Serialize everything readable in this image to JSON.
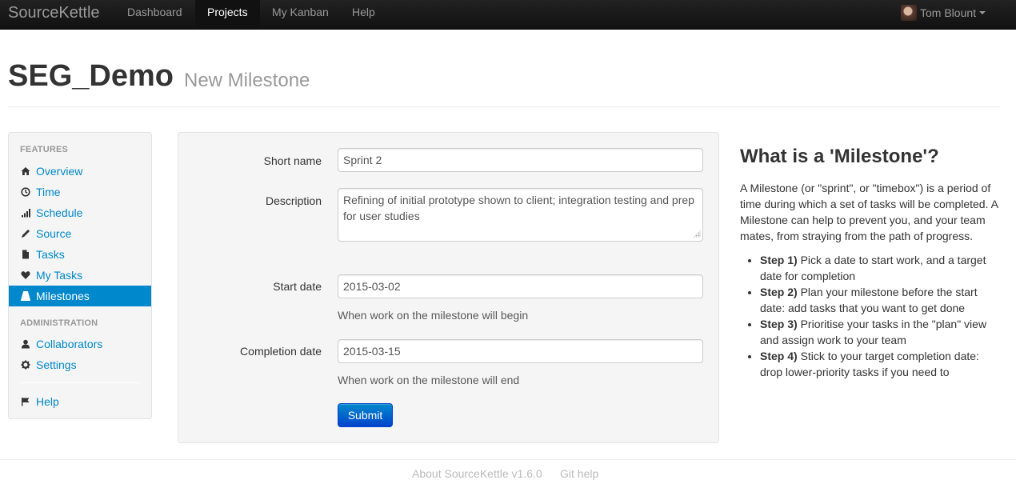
{
  "navbar": {
    "brand": "SourceKettle",
    "items": [
      {
        "label": "Dashboard"
      },
      {
        "label": "Projects"
      },
      {
        "label": "My Kanban"
      },
      {
        "label": "Help"
      }
    ],
    "active_item": "Projects",
    "user": "Tom Blount"
  },
  "header": {
    "title": "SEG_Demo",
    "subtitle": "New Milestone"
  },
  "sidebar": {
    "features_header": "FEATURES",
    "features": [
      {
        "label": "Overview",
        "icon": "home-icon"
      },
      {
        "label": "Time",
        "icon": "clock-icon"
      },
      {
        "label": "Schedule",
        "icon": "signal-icon"
      },
      {
        "label": "Source",
        "icon": "pencil-icon"
      },
      {
        "label": "Tasks",
        "icon": "file-icon"
      },
      {
        "label": "My Tasks",
        "icon": "heart-icon"
      },
      {
        "label": "Milestones",
        "icon": "road-icon"
      }
    ],
    "active_item": "Milestones",
    "admin_header": "ADMINISTRATION",
    "admin": [
      {
        "label": "Collaborators",
        "icon": "user-icon"
      },
      {
        "label": "Settings",
        "icon": "cog-icon"
      }
    ],
    "help": {
      "label": "Help",
      "icon": "flag-icon"
    }
  },
  "form": {
    "short_name": {
      "label": "Short name",
      "value": "Sprint 2"
    },
    "description": {
      "label": "Description",
      "value": "Refining of initial prototype shown to client; integration testing and prep for user studies"
    },
    "start_date": {
      "label": "Start date",
      "value": "2015-03-02",
      "help": "When work on the milestone will begin"
    },
    "completion_date": {
      "label": "Completion date",
      "value": "2015-03-15",
      "help": "When work on the milestone will end"
    },
    "submit_label": "Submit"
  },
  "info": {
    "title": "What is a 'Milestone'?",
    "paragraph": "A Milestone (or \"sprint\", or \"timebox\") is a period of time during which a set of tasks will be completed. A Milestone can help to prevent you, and your team mates, from straying from the path of progress.",
    "steps": [
      {
        "label": "Step 1)",
        "text": "Pick a date to start work, and a target date for completion"
      },
      {
        "label": "Step 2)",
        "text": "Plan your milestone before the start date: add tasks that you want to get done"
      },
      {
        "label": "Step 3)",
        "text": "Prioritise your tasks in the \"plan\" view and assign work to your team"
      },
      {
        "label": "Step 4)",
        "text": "Stick to your target completion date: drop lower-priority tasks if you need to"
      }
    ]
  },
  "footer": {
    "about": "About SourceKettle v1.6.0",
    "git_help": "Git help"
  },
  "colors": {
    "link": "#0088cc",
    "navbar_bg": "#1b1b1b",
    "button": "#0066cc",
    "muted": "#999999"
  }
}
